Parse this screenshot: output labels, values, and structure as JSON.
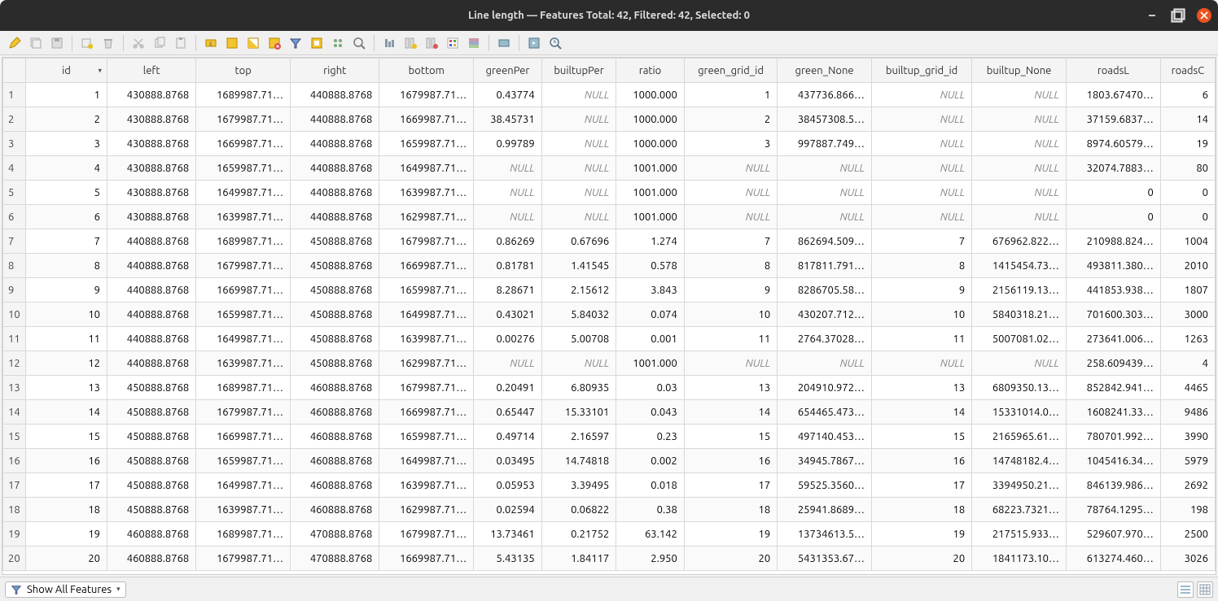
{
  "title": "Line length — Features Total: 42, Filtered: 42, Selected: 0",
  "statusbar": {
    "show_all_label": "Show All Features"
  },
  "columns": [
    "id",
    "left",
    "top",
    "right",
    "bottom",
    "greenPer",
    "builtupPer",
    "ratio",
    "green_grid_id",
    "green_None",
    "builtup_grid_id",
    "builtup_None",
    "roadsL",
    "roadsC"
  ],
  "rows": [
    {
      "n": "1",
      "id": "1",
      "left": "430888.8768",
      "top": "1689987.71…",
      "right": "440888.8768",
      "bottom": "1679987.71…",
      "greenPer": "0.43774",
      "builtupPer": "NULL",
      "ratio": "1000.000",
      "green_grid_id": "1",
      "green_None": "437736.866…",
      "builtup_grid_id": "NULL",
      "builtup_None": "NULL",
      "roadsL": "1803.67470…",
      "roadsC": "6"
    },
    {
      "n": "2",
      "id": "2",
      "left": "430888.8768",
      "top": "1679987.71…",
      "right": "440888.8768",
      "bottom": "1669987.71…",
      "greenPer": "38.45731",
      "builtupPer": "NULL",
      "ratio": "1000.000",
      "green_grid_id": "2",
      "green_None": "38457308.5…",
      "builtup_grid_id": "NULL",
      "builtup_None": "NULL",
      "roadsL": "37159.6837…",
      "roadsC": "14"
    },
    {
      "n": "3",
      "id": "3",
      "left": "430888.8768",
      "top": "1669987.71…",
      "right": "440888.8768",
      "bottom": "1659987.71…",
      "greenPer": "0.99789",
      "builtupPer": "NULL",
      "ratio": "1000.000",
      "green_grid_id": "3",
      "green_None": "997887.749…",
      "builtup_grid_id": "NULL",
      "builtup_None": "NULL",
      "roadsL": "8974.60579…",
      "roadsC": "19"
    },
    {
      "n": "4",
      "id": "4",
      "left": "430888.8768",
      "top": "1659987.71…",
      "right": "440888.8768",
      "bottom": "1649987.71…",
      "greenPer": "NULL",
      "builtupPer": "NULL",
      "ratio": "1001.000",
      "green_grid_id": "NULL",
      "green_None": "NULL",
      "builtup_grid_id": "NULL",
      "builtup_None": "NULL",
      "roadsL": "32074.7883…",
      "roadsC": "80"
    },
    {
      "n": "5",
      "id": "5",
      "left": "430888.8768",
      "top": "1649987.71…",
      "right": "440888.8768",
      "bottom": "1639987.71…",
      "greenPer": "NULL",
      "builtupPer": "NULL",
      "ratio": "1001.000",
      "green_grid_id": "NULL",
      "green_None": "NULL",
      "builtup_grid_id": "NULL",
      "builtup_None": "NULL",
      "roadsL": "0",
      "roadsC": "0"
    },
    {
      "n": "6",
      "id": "6",
      "left": "430888.8768",
      "top": "1639987.71…",
      "right": "440888.8768",
      "bottom": "1629987.71…",
      "greenPer": "NULL",
      "builtupPer": "NULL",
      "ratio": "1001.000",
      "green_grid_id": "NULL",
      "green_None": "NULL",
      "builtup_grid_id": "NULL",
      "builtup_None": "NULL",
      "roadsL": "0",
      "roadsC": "0"
    },
    {
      "n": "7",
      "id": "7",
      "left": "440888.8768",
      "top": "1689987.71…",
      "right": "450888.8768",
      "bottom": "1679987.71…",
      "greenPer": "0.86269",
      "builtupPer": "0.67696",
      "ratio": "1.274",
      "green_grid_id": "7",
      "green_None": "862694.509…",
      "builtup_grid_id": "7",
      "builtup_None": "676962.822…",
      "roadsL": "210988.824…",
      "roadsC": "1004"
    },
    {
      "n": "8",
      "id": "8",
      "left": "440888.8768",
      "top": "1679987.71…",
      "right": "450888.8768",
      "bottom": "1669987.71…",
      "greenPer": "0.81781",
      "builtupPer": "1.41545",
      "ratio": "0.578",
      "green_grid_id": "8",
      "green_None": "817811.791…",
      "builtup_grid_id": "8",
      "builtup_None": "1415454.73…",
      "roadsL": "493811.380…",
      "roadsC": "2010"
    },
    {
      "n": "9",
      "id": "9",
      "left": "440888.8768",
      "top": "1669987.71…",
      "right": "450888.8768",
      "bottom": "1659987.71…",
      "greenPer": "8.28671",
      "builtupPer": "2.15612",
      "ratio": "3.843",
      "green_grid_id": "9",
      "green_None": "8286705.58…",
      "builtup_grid_id": "9",
      "builtup_None": "2156119.13…",
      "roadsL": "441853.938…",
      "roadsC": "1807"
    },
    {
      "n": "10",
      "id": "10",
      "left": "440888.8768",
      "top": "1659987.71…",
      "right": "450888.8768",
      "bottom": "1649987.71…",
      "greenPer": "0.43021",
      "builtupPer": "5.84032",
      "ratio": "0.074",
      "green_grid_id": "10",
      "green_None": "430207.712…",
      "builtup_grid_id": "10",
      "builtup_None": "5840318.21…",
      "roadsL": "701600.303…",
      "roadsC": "3000"
    },
    {
      "n": "11",
      "id": "11",
      "left": "440888.8768",
      "top": "1649987.71…",
      "right": "450888.8768",
      "bottom": "1639987.71…",
      "greenPer": "0.00276",
      "builtupPer": "5.00708",
      "ratio": "0.001",
      "green_grid_id": "11",
      "green_None": "2764.37028…",
      "builtup_grid_id": "11",
      "builtup_None": "5007081.02…",
      "roadsL": "273641.006…",
      "roadsC": "1263"
    },
    {
      "n": "12",
      "id": "12",
      "left": "440888.8768",
      "top": "1639987.71…",
      "right": "450888.8768",
      "bottom": "1629987.71…",
      "greenPer": "NULL",
      "builtupPer": "NULL",
      "ratio": "1001.000",
      "green_grid_id": "NULL",
      "green_None": "NULL",
      "builtup_grid_id": "NULL",
      "builtup_None": "NULL",
      "roadsL": "258.609439…",
      "roadsC": "4"
    },
    {
      "n": "13",
      "id": "13",
      "left": "450888.8768",
      "top": "1689987.71…",
      "right": "460888.8768",
      "bottom": "1679987.71…",
      "greenPer": "0.20491",
      "builtupPer": "6.80935",
      "ratio": "0.03",
      "green_grid_id": "13",
      "green_None": "204910.972…",
      "builtup_grid_id": "13",
      "builtup_None": "6809350.13…",
      "roadsL": "852842.941…",
      "roadsC": "4465"
    },
    {
      "n": "14",
      "id": "14",
      "left": "450888.8768",
      "top": "1679987.71…",
      "right": "460888.8768",
      "bottom": "1669987.71…",
      "greenPer": "0.65447",
      "builtupPer": "15.33101",
      "ratio": "0.043",
      "green_grid_id": "14",
      "green_None": "654465.473…",
      "builtup_grid_id": "14",
      "builtup_None": "15331014.0…",
      "roadsL": "1608241.33…",
      "roadsC": "9486"
    },
    {
      "n": "15",
      "id": "15",
      "left": "450888.8768",
      "top": "1669987.71…",
      "right": "460888.8768",
      "bottom": "1659987.71…",
      "greenPer": "0.49714",
      "builtupPer": "2.16597",
      "ratio": "0.23",
      "green_grid_id": "15",
      "green_None": "497140.453…",
      "builtup_grid_id": "15",
      "builtup_None": "2165965.61…",
      "roadsL": "780701.992…",
      "roadsC": "3990"
    },
    {
      "n": "16",
      "id": "16",
      "left": "450888.8768",
      "top": "1659987.71…",
      "right": "460888.8768",
      "bottom": "1649987.71…",
      "greenPer": "0.03495",
      "builtupPer": "14.74818",
      "ratio": "0.002",
      "green_grid_id": "16",
      "green_None": "34945.7867…",
      "builtup_grid_id": "16",
      "builtup_None": "14748182.4…",
      "roadsL": "1045416.34…",
      "roadsC": "5979"
    },
    {
      "n": "17",
      "id": "17",
      "left": "450888.8768",
      "top": "1649987.71…",
      "right": "460888.8768",
      "bottom": "1639987.71…",
      "greenPer": "0.05953",
      "builtupPer": "3.39495",
      "ratio": "0.018",
      "green_grid_id": "17",
      "green_None": "59525.3560…",
      "builtup_grid_id": "17",
      "builtup_None": "3394950.21…",
      "roadsL": "846139.986…",
      "roadsC": "2692"
    },
    {
      "n": "18",
      "id": "18",
      "left": "450888.8768",
      "top": "1639987.71…",
      "right": "460888.8768",
      "bottom": "1629987.71…",
      "greenPer": "0.02594",
      "builtupPer": "0.06822",
      "ratio": "0.38",
      "green_grid_id": "18",
      "green_None": "25941.8689…",
      "builtup_grid_id": "18",
      "builtup_None": "68223.7321…",
      "roadsL": "78764.1295…",
      "roadsC": "198"
    },
    {
      "n": "19",
      "id": "19",
      "left": "460888.8768",
      "top": "1689987.71…",
      "right": "470888.8768",
      "bottom": "1679987.71…",
      "greenPer": "13.73461",
      "builtupPer": "0.21752",
      "ratio": "63.142",
      "green_grid_id": "19",
      "green_None": "13734613.5…",
      "builtup_grid_id": "19",
      "builtup_None": "217515.933…",
      "roadsL": "529607.970…",
      "roadsC": "2500"
    },
    {
      "n": "20",
      "id": "20",
      "left": "460888.8768",
      "top": "1679987.71…",
      "right": "470888.8768",
      "bottom": "1669987.71…",
      "greenPer": "5.43135",
      "builtupPer": "1.84117",
      "ratio": "2.950",
      "green_grid_id": "20",
      "green_None": "5431353.67…",
      "builtup_grid_id": "20",
      "builtup_None": "1841173.10…",
      "roadsL": "613274.460…",
      "roadsC": "3026"
    }
  ]
}
